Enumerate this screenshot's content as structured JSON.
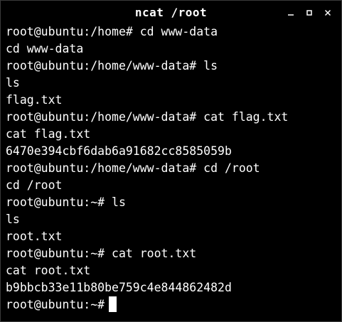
{
  "window": {
    "title": "ncat /root",
    "controls": [
      "minimize",
      "maximize",
      "close"
    ],
    "background": "#000000",
    "foreground": "#ffffff"
  },
  "terminal": {
    "lines": [
      "root@ubuntu:/home# cd www-data",
      "cd www-data",
      "root@ubuntu:/home/www-data# ls",
      "ls",
      "flag.txt",
      "root@ubuntu:/home/www-data# cat flag.txt",
      "cat flag.txt",
      "6470e394cbf6dab6a91682cc8585059b",
      "root@ubuntu:/home/www-data# cd /root",
      "cd /root",
      "root@ubuntu:~# ls",
      "ls",
      "root.txt",
      "root@ubuntu:~# cat root.txt",
      "cat root.txt",
      "b9bbcb33e11b80be759c4e844862482d"
    ],
    "prompt": "root@ubuntu:~#"
  }
}
